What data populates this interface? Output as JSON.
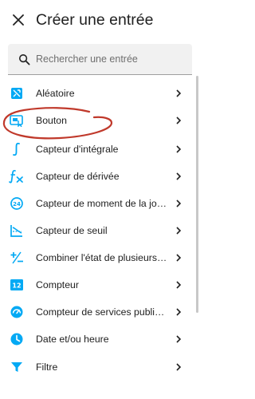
{
  "header": {
    "title": "Créer une entrée",
    "close_icon": "close-icon"
  },
  "search": {
    "placeholder": "Rechercher une entrée",
    "value": "",
    "icon": "search-icon"
  },
  "list": {
    "items": [
      {
        "label": "Aléatoire",
        "icon": "random-icon"
      },
      {
        "label": "Bouton",
        "icon": "button-icon"
      },
      {
        "label": "Capteur d'intégrale",
        "icon": "integral-icon"
      },
      {
        "label": "Capteur de dérivée",
        "icon": "derivative-icon"
      },
      {
        "label": "Capteur de moment de la journée",
        "icon": "time-of-day-icon"
      },
      {
        "label": "Capteur de seuil",
        "icon": "threshold-icon"
      },
      {
        "label": "Combiner l'état de plusieurs capteurs",
        "icon": "combine-icon"
      },
      {
        "label": "Compteur",
        "icon": "counter-icon"
      },
      {
        "label": "Compteur de services publics (énergie, eau, gaz)",
        "icon": "utility-meter-icon"
      },
      {
        "label": "Date et/ou heure",
        "icon": "clock-icon"
      },
      {
        "label": "Filtre",
        "icon": "filter-icon"
      }
    ]
  },
  "colors": {
    "accent": "#03a9f4",
    "annotation": "#c0392b",
    "text": "#212121"
  }
}
